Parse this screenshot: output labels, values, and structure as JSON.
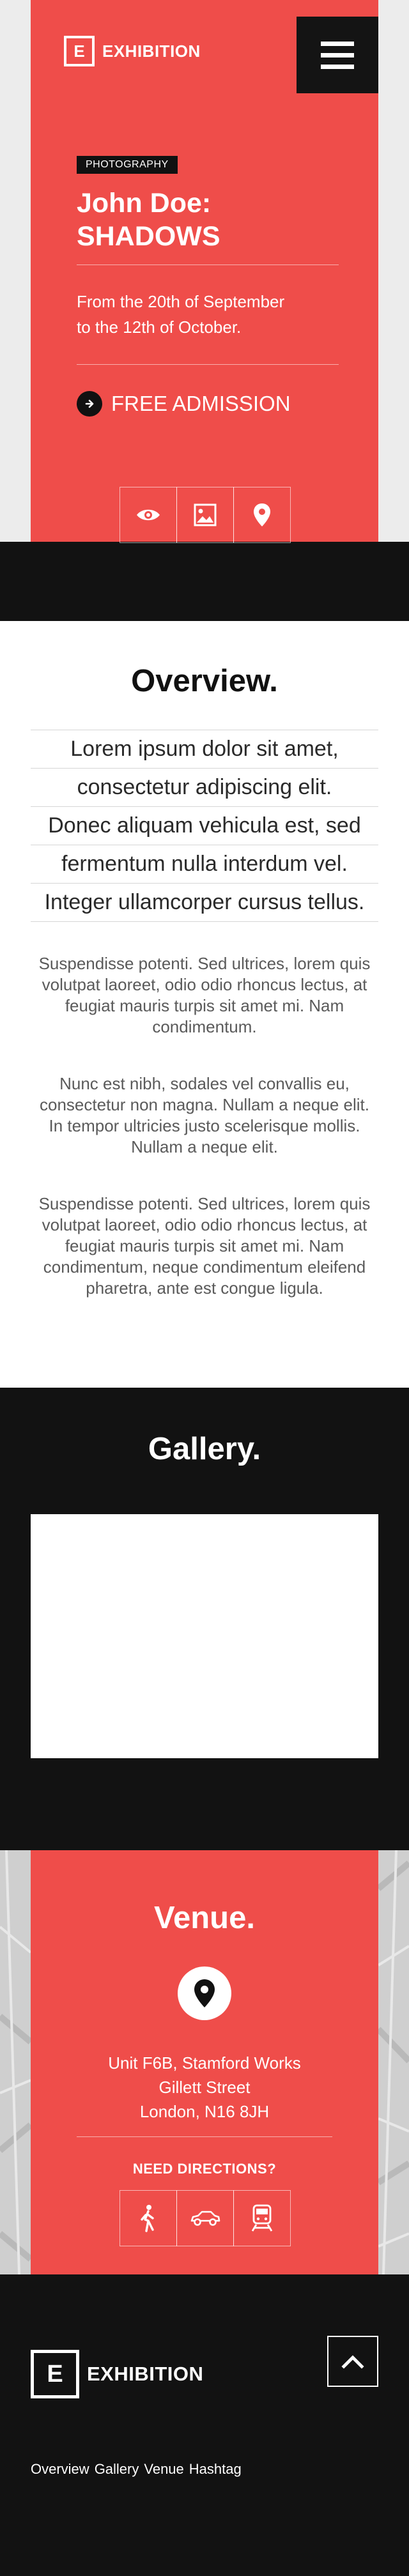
{
  "header": {
    "logo_letter": "E",
    "logo_text": "EXHIBITION"
  },
  "hero": {
    "tag": "PHOTOGRAPHY",
    "title_line1": "John Doe:",
    "title_line2": "SHADOWS",
    "dates_line1": "From the 20th of September",
    "dates_line2": "to the 12th of October.",
    "admission": "FREE ADMISSION",
    "icons": [
      "eye-icon",
      "image-icon",
      "map-pin-icon"
    ]
  },
  "overview": {
    "title": "Overview.",
    "lead_lines": [
      "Lorem ipsum dolor sit amet,",
      "consectetur adipiscing elit.",
      "Donec aliquam vehicula est, sed",
      "fermentum nulla interdum vel.",
      "Integer ullamcorper cursus tellus."
    ],
    "paragraphs": [
      "Suspendisse potenti. Sed ultrices, lorem quis volutpat laoreet, odio odio rhoncus lectus, at feugiat mauris turpis sit amet mi. Nam condimentum.",
      "Nunc est nibh, sodales vel convallis eu, consectetur non magna. Nullam a neque elit. In tempor ultricies justo scelerisque mollis. Nullam a neque elit.",
      "Suspendisse potenti. Sed ultrices, lorem quis volutpat laoreet, odio odio rhoncus lectus, at feugiat mauris turpis sit amet mi. Nam condimentum, neque condimentum eleifend pharetra, ante est congue ligula."
    ]
  },
  "gallery": {
    "title": "Gallery."
  },
  "venue": {
    "title": "Venue.",
    "address_line1": "Unit F6B, Stamford Works",
    "address_line2": "Gillett Street",
    "address_line3": "London, N16 8JH",
    "directions_label": "NEED DIRECTIONS?",
    "transport_icons": [
      "walking-icon",
      "car-icon",
      "train-icon"
    ]
  },
  "footer": {
    "logo_letter": "E",
    "logo_text": "EXHIBITION",
    "nav": [
      "Overview",
      "Gallery",
      "Venue",
      "Hashtag"
    ]
  },
  "colors": {
    "accent": "#ef4d4a",
    "dark": "#121212",
    "light": "#ececec"
  }
}
